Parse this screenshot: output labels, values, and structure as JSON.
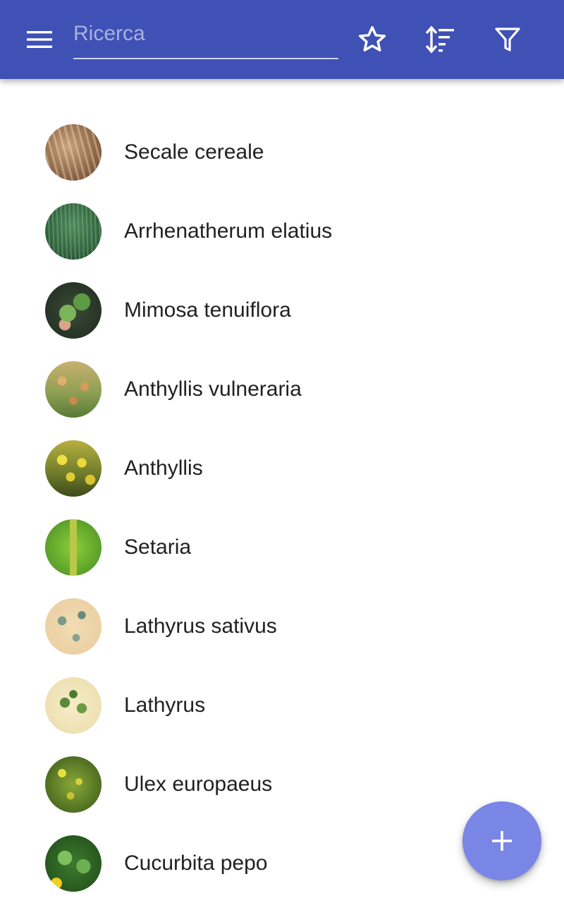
{
  "toolbar": {
    "background_color": "#3f51b5",
    "search": {
      "placeholder": "Ricerca",
      "value": ""
    },
    "icons": {
      "menu": "menu-icon",
      "favorites": "star-outline-icon",
      "sort": "sort-icon",
      "filter": "filter-icon"
    }
  },
  "plants": {
    "items": [
      {
        "name": "Secale cereale",
        "thumbnail": "rye-photo"
      },
      {
        "name": "Arrhenatherum elatius",
        "thumbnail": "oat-grass-photo"
      },
      {
        "name": "Mimosa tenuiflora",
        "thumbnail": "mimosa-photo"
      },
      {
        "name": "Anthyllis vulneraria",
        "thumbnail": "kidney-vetch-photo"
      },
      {
        "name": "Anthyllis",
        "thumbnail": "anthyllis-photo"
      },
      {
        "name": "Setaria",
        "thumbnail": "foxtail-photo"
      },
      {
        "name": "Lathyrus sativus",
        "thumbnail": "grass-pea-illustration"
      },
      {
        "name": "Lathyrus",
        "thumbnail": "lathyrus-illustration"
      },
      {
        "name": "Ulex europaeus",
        "thumbnail": "gorse-photo"
      },
      {
        "name": "Cucurbita pepo",
        "thumbnail": "zucchini-photo"
      }
    ]
  },
  "fab": {
    "icon": "plus-icon",
    "color": "#7986e6"
  }
}
